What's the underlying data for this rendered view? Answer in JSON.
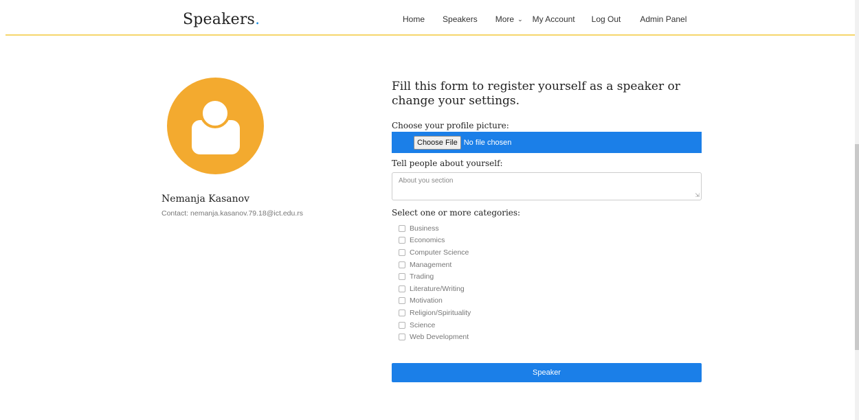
{
  "header": {
    "brand": "Speakers",
    "brand_dot": ".",
    "nav": {
      "home": "Home",
      "speakers": "Speakers",
      "more": "More",
      "account": "My Account",
      "logout": "Log Out",
      "admin": "Admin Panel"
    }
  },
  "profile": {
    "avatar_icon": "user-avatar-icon",
    "name": "Nemanja Kasanov",
    "contact": "Contact: nemanja.kasanov.79.18@ict.edu.rs"
  },
  "form": {
    "title": "Fill this form to register yourself as a speaker or change your settings.",
    "picture_label": "Choose your profile picture:",
    "file_button": "Choose File",
    "file_status": "No file chosen",
    "about_label": "Tell people about yourself:",
    "about_placeholder": "About you section",
    "categories_label": "Select one or more categories:",
    "categories": [
      "Business",
      "Economics",
      "Computer Science",
      "Management",
      "Trading",
      "Literature/Writing",
      "Motivation",
      "Religion/Spirituality",
      "Science",
      "Web Development"
    ],
    "submit_label": "Speaker"
  },
  "colors": {
    "accent_blue": "#1b7fe8",
    "header_border": "#f5d66b",
    "avatar_orange": "#f3aa2f"
  }
}
